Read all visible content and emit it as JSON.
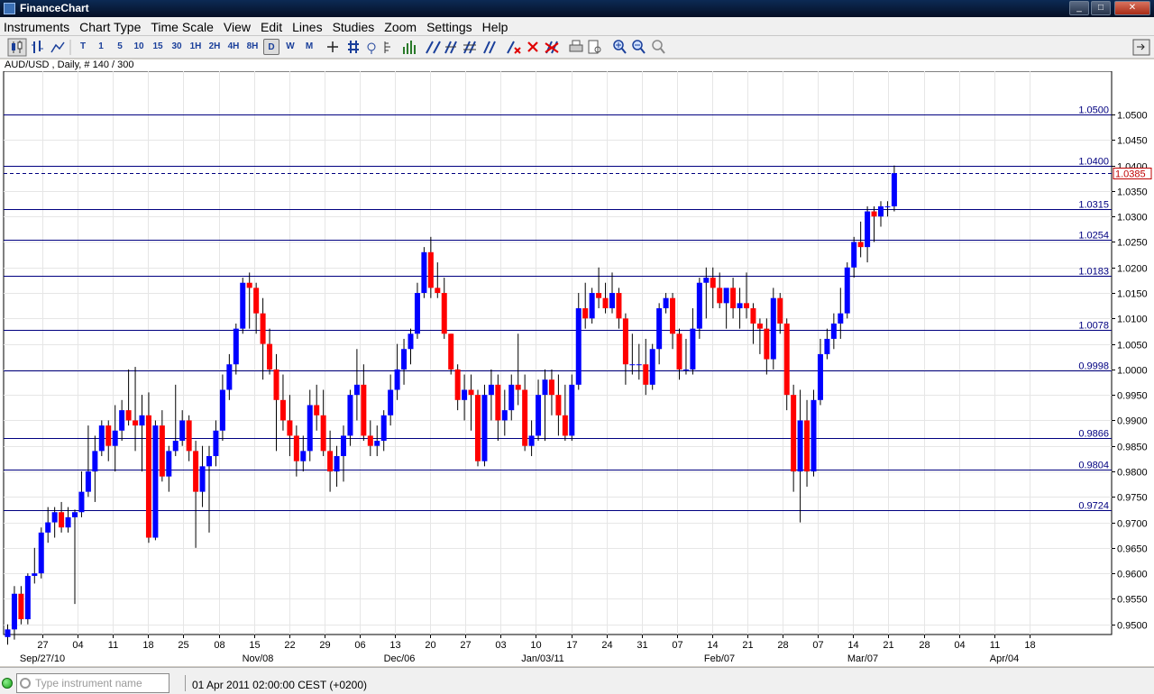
{
  "window": {
    "title": "FinanceChart",
    "min": "_",
    "max": "□",
    "close": "✕"
  },
  "menu": [
    "Instruments",
    "Chart Type",
    "Time Scale",
    "View",
    "Edit",
    "Lines",
    "Studies",
    "Zoom",
    "Settings",
    "Help"
  ],
  "toolbar": {
    "timeframes": [
      "T",
      "1",
      "5",
      "10",
      "15",
      "30",
      "1H",
      "2H",
      "4H",
      "8H",
      "D",
      "W",
      "M"
    ],
    "active_timeframe": "D"
  },
  "chart_info": "AUD/USD , Daily, # 140 / 300",
  "status": {
    "instrument_placeholder": "Type instrument name",
    "datetime": "01 Apr 2011 02:00:00  CEST (+0200)"
  },
  "colors": {
    "up": "#0000ff",
    "down": "#ff0000",
    "level_line": "#000080",
    "dashed_line": "#000080",
    "current_price": "#c00000"
  },
  "chart_data": {
    "type": "candlestick",
    "instrument": "AUD/USD",
    "period": "Daily",
    "ylim": [
      0.948,
      1.0585
    ],
    "x_axis_days": [
      "27",
      "04",
      "11",
      "18",
      "25",
      "08",
      "15",
      "22",
      "29",
      "06",
      "13",
      "20",
      "27",
      "03",
      "10",
      "17",
      "24",
      "31",
      "07",
      "14",
      "21",
      "28",
      "07",
      "14",
      "21",
      "28",
      "04",
      "11",
      "18"
    ],
    "x_axis_months": [
      "Sep/27/10",
      "Nov/08",
      "Dec/06",
      "Jan/03/11",
      "Feb/07",
      "Mar/07",
      "Apr/04"
    ],
    "y_ticks": [
      "1.0500",
      "1.0450",
      "1.0400",
      "1.0350",
      "1.0300",
      "1.0250",
      "1.0200",
      "1.0150",
      "1.0100",
      "1.0050",
      "1.0000",
      "0.9950",
      "0.9900",
      "0.9850",
      "0.9800",
      "0.9750",
      "0.9700",
      "0.9650",
      "0.9600",
      "0.9550",
      "0.9500"
    ],
    "horizontal_levels": [
      1.05,
      1.04,
      1.0315,
      1.0254,
      1.0183,
      1.0078,
      0.9998,
      0.9866,
      0.9804,
      0.9724
    ],
    "level_labels": [
      "1.0500",
      "1.0400",
      "1.0315",
      "1.0254",
      "1.0183",
      "1.0078",
      "0.9998",
      "0.9866",
      "0.9804",
      "0.9724"
    ],
    "current_price": 1.0385,
    "current_price_label": "1.0385",
    "dashed_level": 1.0385,
    "series": [
      {
        "o": 0.9475,
        "h": 0.95,
        "l": 0.946,
        "c": 0.949
      },
      {
        "o": 0.949,
        "h": 0.9575,
        "l": 0.947,
        "c": 0.956
      },
      {
        "o": 0.956,
        "h": 0.9575,
        "l": 0.95,
        "c": 0.951
      },
      {
        "o": 0.951,
        "h": 0.96,
        "l": 0.95,
        "c": 0.9595
      },
      {
        "o": 0.9595,
        "h": 0.965,
        "l": 0.958,
        "c": 0.96
      },
      {
        "o": 0.96,
        "h": 0.969,
        "l": 0.959,
        "c": 0.968
      },
      {
        "o": 0.968,
        "h": 0.973,
        "l": 0.966,
        "c": 0.97
      },
      {
        "o": 0.97,
        "h": 0.973,
        "l": 0.967,
        "c": 0.972
      },
      {
        "o": 0.972,
        "h": 0.974,
        "l": 0.968,
        "c": 0.969
      },
      {
        "o": 0.969,
        "h": 0.973,
        "l": 0.968,
        "c": 0.971
      },
      {
        "o": 0.971,
        "h": 0.9725,
        "l": 0.954,
        "c": 0.972
      },
      {
        "o": 0.972,
        "h": 0.98,
        "l": 0.971,
        "c": 0.976
      },
      {
        "o": 0.976,
        "h": 0.989,
        "l": 0.975,
        "c": 0.98
      },
      {
        "o": 0.98,
        "h": 0.987,
        "l": 0.974,
        "c": 0.984
      },
      {
        "o": 0.984,
        "h": 0.99,
        "l": 0.983,
        "c": 0.989
      },
      {
        "o": 0.989,
        "h": 0.99,
        "l": 0.982,
        "c": 0.985
      },
      {
        "o": 0.985,
        "h": 0.993,
        "l": 0.98,
        "c": 0.988
      },
      {
        "o": 0.988,
        "h": 0.994,
        "l": 0.986,
        "c": 0.992
      },
      {
        "o": 0.992,
        "h": 1.0,
        "l": 0.989,
        "c": 0.99
      },
      {
        "o": 0.99,
        "h": 1.0005,
        "l": 0.984,
        "c": 0.989
      },
      {
        "o": 0.989,
        "h": 0.995,
        "l": 0.98,
        "c": 0.991
      },
      {
        "o": 0.991,
        "h": 0.9955,
        "l": 0.966,
        "c": 0.967
      },
      {
        "o": 0.967,
        "h": 0.99,
        "l": 0.9665,
        "c": 0.989
      },
      {
        "o": 0.989,
        "h": 0.992,
        "l": 0.978,
        "c": 0.979
      },
      {
        "o": 0.979,
        "h": 0.985,
        "l": 0.976,
        "c": 0.984
      },
      {
        "o": 0.984,
        "h": 0.997,
        "l": 0.983,
        "c": 0.986
      },
      {
        "o": 0.986,
        "h": 0.992,
        "l": 0.985,
        "c": 0.99
      },
      {
        "o": 0.99,
        "h": 0.991,
        "l": 0.982,
        "c": 0.984
      },
      {
        "o": 0.984,
        "h": 0.986,
        "l": 0.965,
        "c": 0.976
      },
      {
        "o": 0.976,
        "h": 0.985,
        "l": 0.973,
        "c": 0.981
      },
      {
        "o": 0.981,
        "h": 0.985,
        "l": 0.968,
        "c": 0.983
      },
      {
        "o": 0.983,
        "h": 0.99,
        "l": 0.981,
        "c": 0.988
      },
      {
        "o": 0.988,
        "h": 0.999,
        "l": 0.986,
        "c": 0.996
      },
      {
        "o": 0.996,
        "h": 1.003,
        "l": 0.994,
        "c": 1.001
      },
      {
        "o": 1.001,
        "h": 1.009,
        "l": 0.999,
        "c": 1.008
      },
      {
        "o": 1.008,
        "h": 1.018,
        "l": 1.007,
        "c": 1.017
      },
      {
        "o": 1.017,
        "h": 1.019,
        "l": 1.008,
        "c": 1.016
      },
      {
        "o": 1.016,
        "h": 1.017,
        "l": 1.007,
        "c": 1.011
      },
      {
        "o": 1.011,
        "h": 1.014,
        "l": 0.998,
        "c": 1.005
      },
      {
        "o": 1.005,
        "h": 1.008,
        "l": 0.999,
        "c": 1.0
      },
      {
        "o": 1.0,
        "h": 1.003,
        "l": 0.984,
        "c": 0.994
      },
      {
        "o": 0.994,
        "h": 0.999,
        "l": 0.988,
        "c": 0.99
      },
      {
        "o": 0.99,
        "h": 0.995,
        "l": 0.983,
        "c": 0.987
      },
      {
        "o": 0.987,
        "h": 0.989,
        "l": 0.979,
        "c": 0.982
      },
      {
        "o": 0.982,
        "h": 0.987,
        "l": 0.98,
        "c": 0.984
      },
      {
        "o": 0.984,
        "h": 0.996,
        "l": 0.982,
        "c": 0.993
      },
      {
        "o": 0.993,
        "h": 0.997,
        "l": 0.988,
        "c": 0.991
      },
      {
        "o": 0.991,
        "h": 0.996,
        "l": 0.983,
        "c": 0.984
      },
      {
        "o": 0.984,
        "h": 0.988,
        "l": 0.976,
        "c": 0.98
      },
      {
        "o": 0.98,
        "h": 0.985,
        "l": 0.977,
        "c": 0.983
      },
      {
        "o": 0.983,
        "h": 0.989,
        "l": 0.978,
        "c": 0.987
      },
      {
        "o": 0.987,
        "h": 0.996,
        "l": 0.985,
        "c": 0.995
      },
      {
        "o": 0.995,
        "h": 1.004,
        "l": 0.99,
        "c": 0.997
      },
      {
        "o": 0.997,
        "h": 1.001,
        "l": 0.986,
        "c": 0.987
      },
      {
        "o": 0.987,
        "h": 0.99,
        "l": 0.983,
        "c": 0.985
      },
      {
        "o": 0.985,
        "h": 0.989,
        "l": 0.983,
        "c": 0.986
      },
      {
        "o": 0.986,
        "h": 0.992,
        "l": 0.984,
        "c": 0.991
      },
      {
        "o": 0.991,
        "h": 0.999,
        "l": 0.989,
        "c": 0.996
      },
      {
        "o": 0.996,
        "h": 1.005,
        "l": 0.994,
        "c": 1.0
      },
      {
        "o": 1.0,
        "h": 1.006,
        "l": 0.997,
        "c": 1.004
      },
      {
        "o": 1.004,
        "h": 1.008,
        "l": 1.001,
        "c": 1.007
      },
      {
        "o": 1.007,
        "h": 1.017,
        "l": 1.006,
        "c": 1.015
      },
      {
        "o": 1.015,
        "h": 1.024,
        "l": 1.014,
        "c": 1.023
      },
      {
        "o": 1.023,
        "h": 1.026,
        "l": 1.014,
        "c": 1.016
      },
      {
        "o": 1.016,
        "h": 1.021,
        "l": 1.014,
        "c": 1.015
      },
      {
        "o": 1.015,
        "h": 1.018,
        "l": 1.006,
        "c": 1.007
      },
      {
        "o": 1.007,
        "h": 1.007,
        "l": 0.999,
        "c": 1.0
      },
      {
        "o": 1.0,
        "h": 1.001,
        "l": 0.992,
        "c": 0.994
      },
      {
        "o": 0.994,
        "h": 0.999,
        "l": 0.99,
        "c": 0.996
      },
      {
        "o": 0.996,
        "h": 0.999,
        "l": 0.988,
        "c": 0.995
      },
      {
        "o": 0.995,
        "h": 0.996,
        "l": 0.981,
        "c": 0.982
      },
      {
        "o": 0.982,
        "h": 0.997,
        "l": 0.981,
        "c": 0.995
      },
      {
        "o": 0.995,
        "h": 1.0,
        "l": 0.99,
        "c": 0.997
      },
      {
        "o": 0.997,
        "h": 0.999,
        "l": 0.986,
        "c": 0.99
      },
      {
        "o": 0.99,
        "h": 0.996,
        "l": 0.987,
        "c": 0.992
      },
      {
        "o": 0.992,
        "h": 0.999,
        "l": 0.99,
        "c": 0.997
      },
      {
        "o": 0.997,
        "h": 1.007,
        "l": 0.993,
        "c": 0.996
      },
      {
        "o": 0.996,
        "h": 0.999,
        "l": 0.984,
        "c": 0.985
      },
      {
        "o": 0.985,
        "h": 0.99,
        "l": 0.983,
        "c": 0.987
      },
      {
        "o": 0.987,
        "h": 0.998,
        "l": 0.986,
        "c": 0.995
      },
      {
        "o": 0.995,
        "h": 1.0,
        "l": 0.986,
        "c": 0.998
      },
      {
        "o": 0.998,
        "h": 1.0,
        "l": 0.991,
        "c": 0.995
      },
      {
        "o": 0.995,
        "h": 0.999,
        "l": 0.987,
        "c": 0.991
      },
      {
        "o": 0.991,
        "h": 0.997,
        "l": 0.986,
        "c": 0.987
      },
      {
        "o": 0.987,
        "h": 0.999,
        "l": 0.986,
        "c": 0.997
      },
      {
        "o": 0.997,
        "h": 1.015,
        "l": 0.996,
        "c": 1.012
      },
      {
        "o": 1.012,
        "h": 1.017,
        "l": 1.008,
        "c": 1.01
      },
      {
        "o": 1.01,
        "h": 1.016,
        "l": 1.009,
        "c": 1.015
      },
      {
        "o": 1.015,
        "h": 1.02,
        "l": 1.012,
        "c": 1.014
      },
      {
        "o": 1.014,
        "h": 1.017,
        "l": 1.011,
        "c": 1.012
      },
      {
        "o": 1.012,
        "h": 1.019,
        "l": 1.011,
        "c": 1.015
      },
      {
        "o": 1.015,
        "h": 1.016,
        "l": 1.008,
        "c": 1.01
      },
      {
        "o": 1.01,
        "h": 1.011,
        "l": 0.997,
        "c": 1.001
      },
      {
        "o": 1.001,
        "h": 1.007,
        "l": 0.999,
        "c": 1.001
      },
      {
        "o": 1.001,
        "h": 1.005,
        "l": 0.998,
        "c": 1.001
      },
      {
        "o": 1.001,
        "h": 1.006,
        "l": 0.995,
        "c": 0.997
      },
      {
        "o": 0.997,
        "h": 1.005,
        "l": 0.996,
        "c": 1.004
      },
      {
        "o": 1.004,
        "h": 1.013,
        "l": 1.001,
        "c": 1.012
      },
      {
        "o": 1.012,
        "h": 1.015,
        "l": 1.011,
        "c": 1.014
      },
      {
        "o": 1.014,
        "h": 1.015,
        "l": 1.004,
        "c": 1.007
      },
      {
        "o": 1.007,
        "h": 1.008,
        "l": 0.998,
        "c": 1.0
      },
      {
        "o": 1.0,
        "h": 1.006,
        "l": 0.999,
        "c": 1.0
      },
      {
        "o": 1.0,
        "h": 1.012,
        "l": 0.999,
        "c": 1.008
      },
      {
        "o": 1.008,
        "h": 1.018,
        "l": 1.006,
        "c": 1.017
      },
      {
        "o": 1.017,
        "h": 1.02,
        "l": 1.01,
        "c": 1.018
      },
      {
        "o": 1.018,
        "h": 1.02,
        "l": 1.012,
        "c": 1.016
      },
      {
        "o": 1.016,
        "h": 1.019,
        "l": 1.012,
        "c": 1.013
      },
      {
        "o": 1.013,
        "h": 1.015,
        "l": 1.008,
        "c": 1.016
      },
      {
        "o": 1.016,
        "h": 1.018,
        "l": 1.01,
        "c": 1.012
      },
      {
        "o": 1.012,
        "h": 1.016,
        "l": 1.008,
        "c": 1.013
      },
      {
        "o": 1.013,
        "h": 1.019,
        "l": 1.01,
        "c": 1.012
      },
      {
        "o": 1.012,
        "h": 1.013,
        "l": 1.005,
        "c": 1.009
      },
      {
        "o": 1.009,
        "h": 1.01,
        "l": 1.003,
        "c": 1.008
      },
      {
        "o": 1.008,
        "h": 1.01,
        "l": 0.999,
        "c": 1.002
      },
      {
        "o": 1.002,
        "h": 1.016,
        "l": 1.0,
        "c": 1.014
      },
      {
        "o": 1.014,
        "h": 1.015,
        "l": 1.007,
        "c": 1.009
      },
      {
        "o": 1.009,
        "h": 1.01,
        "l": 0.992,
        "c": 0.995
      },
      {
        "o": 0.995,
        "h": 0.997,
        "l": 0.976,
        "c": 0.98
      },
      {
        "o": 0.98,
        "h": 0.996,
        "l": 0.97,
        "c": 0.99
      },
      {
        "o": 0.99,
        "h": 0.994,
        "l": 0.977,
        "c": 0.98
      },
      {
        "o": 0.98,
        "h": 0.996,
        "l": 0.979,
        "c": 0.994
      },
      {
        "o": 0.994,
        "h": 1.006,
        "l": 0.993,
        "c": 1.003
      },
      {
        "o": 1.003,
        "h": 1.008,
        "l": 1.002,
        "c": 1.006
      },
      {
        "o": 1.006,
        "h": 1.011,
        "l": 1.004,
        "c": 1.009
      },
      {
        "o": 1.009,
        "h": 1.016,
        "l": 1.006,
        "c": 1.011
      },
      {
        "o": 1.011,
        "h": 1.021,
        "l": 1.01,
        "c": 1.02
      },
      {
        "o": 1.02,
        "h": 1.026,
        "l": 1.018,
        "c": 1.025
      },
      {
        "o": 1.025,
        "h": 1.029,
        "l": 1.022,
        "c": 1.024
      },
      {
        "o": 1.024,
        "h": 1.032,
        "l": 1.021,
        "c": 1.031
      },
      {
        "o": 1.031,
        "h": 1.032,
        "l": 1.025,
        "c": 1.03
      },
      {
        "o": 1.03,
        "h": 1.033,
        "l": 1.028,
        "c": 1.032
      },
      {
        "o": 1.032,
        "h": 1.033,
        "l": 1.03,
        "c": 1.032
      },
      {
        "o": 1.032,
        "h": 1.04,
        "l": 1.031,
        "c": 1.0385
      }
    ]
  }
}
